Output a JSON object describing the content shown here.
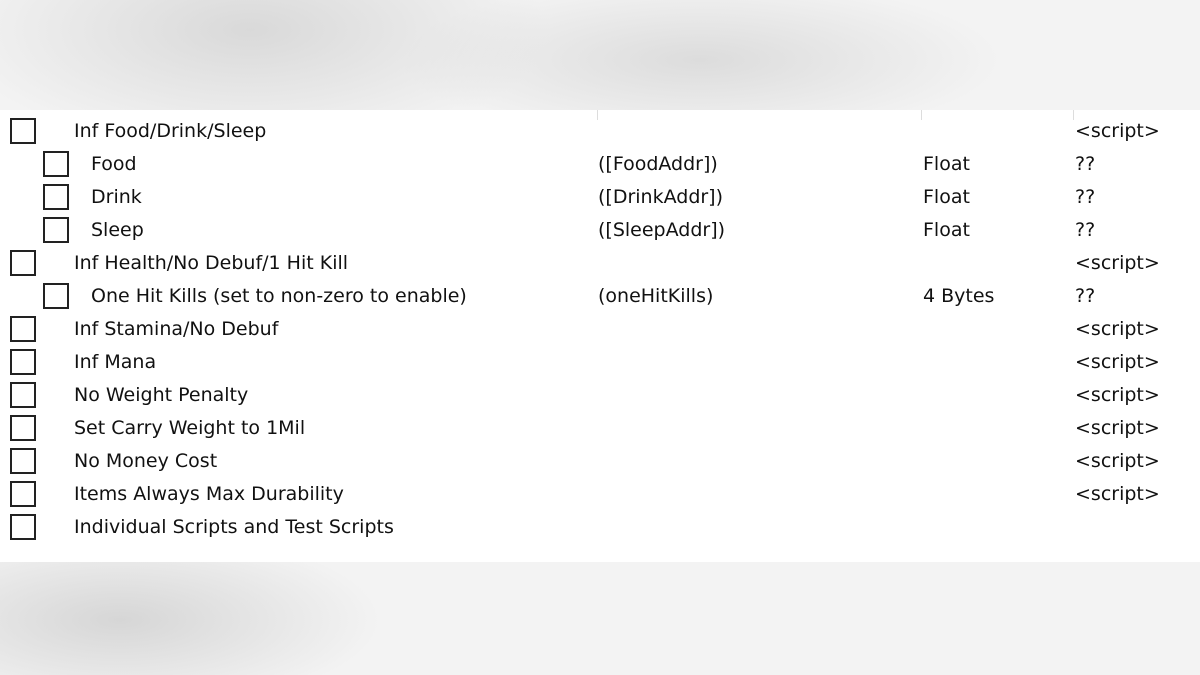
{
  "rows": [
    {
      "desc": "Inf Food/Drink/Sleep",
      "address": "",
      "type": "",
      "value": "<script>",
      "level": 0
    },
    {
      "desc": "Food",
      "address": "([FoodAddr])",
      "type": "Float",
      "value": "??",
      "level": 1
    },
    {
      "desc": "Drink",
      "address": "([DrinkAddr])",
      "type": "Float",
      "value": "??",
      "level": 1
    },
    {
      "desc": "Sleep",
      "address": "([SleepAddr])",
      "type": "Float",
      "value": "??",
      "level": 1
    },
    {
      "desc": "Inf Health/No Debuf/1 Hit Kill",
      "address": "",
      "type": "",
      "value": "<script>",
      "level": 0
    },
    {
      "desc": "One Hit Kills (set to non-zero to enable)",
      "address": "(oneHitKills)",
      "type": "4 Bytes",
      "value": "??",
      "level": 1
    },
    {
      "desc": "Inf Stamina/No Debuf",
      "address": "",
      "type": "",
      "value": "<script>",
      "level": 0
    },
    {
      "desc": "Inf Mana",
      "address": "",
      "type": "",
      "value": "<script>",
      "level": 0
    },
    {
      "desc": "No Weight Penalty",
      "address": "",
      "type": "",
      "value": "<script>",
      "level": 0
    },
    {
      "desc": "Set Carry Weight to 1Mil",
      "address": "",
      "type": "",
      "value": "<script>",
      "level": 0
    },
    {
      "desc": "No Money Cost",
      "address": "",
      "type": "",
      "value": "<script>",
      "level": 0
    },
    {
      "desc": "Items Always Max Durability",
      "address": "",
      "type": "",
      "value": "<script>",
      "level": 0
    },
    {
      "desc": "Individual Scripts and Test Scripts",
      "address": "",
      "type": "",
      "value": "",
      "level": 0
    }
  ]
}
